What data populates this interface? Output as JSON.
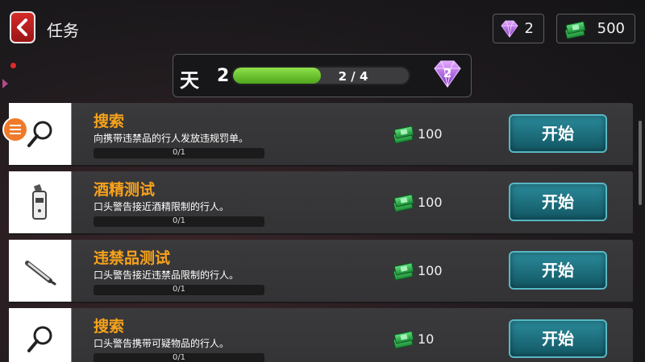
{
  "header": {
    "title": "任务",
    "back_icon": "chevron-left-icon",
    "gems": "2",
    "cash": "500"
  },
  "day": {
    "label": "天",
    "number": "2",
    "progress_done": "2",
    "progress_sep": "/",
    "progress_total": "4",
    "progress_fraction": 0.5,
    "reward_gems": "2"
  },
  "tasks": [
    {
      "title": "搜索",
      "desc": "向携带违禁品的行人发放违规罚单。",
      "progress": "0/1",
      "reward": "100",
      "button": "开始",
      "icon": "magnifier-icon"
    },
    {
      "title": "酒精测试",
      "desc": "口头警告接近酒精限制的行人。",
      "progress": "0/1",
      "reward": "100",
      "button": "开始",
      "icon": "breathalyzer-icon"
    },
    {
      "title": "违禁品测试",
      "desc": "口头警告接近违禁品限制的行人。",
      "progress": "0/1",
      "reward": "100",
      "button": "开始",
      "icon": "test-pen-icon"
    },
    {
      "title": "搜索",
      "desc": "口头警告携带可疑物品的行人。",
      "progress": "0/1",
      "reward": "10",
      "button": "开始",
      "icon": "magnifier-icon"
    }
  ],
  "colors": {
    "accent_orange": "#f7a21b",
    "button_teal": "#1e7482",
    "progress_green": "#6cc532",
    "back_red": "#c41d1d"
  }
}
